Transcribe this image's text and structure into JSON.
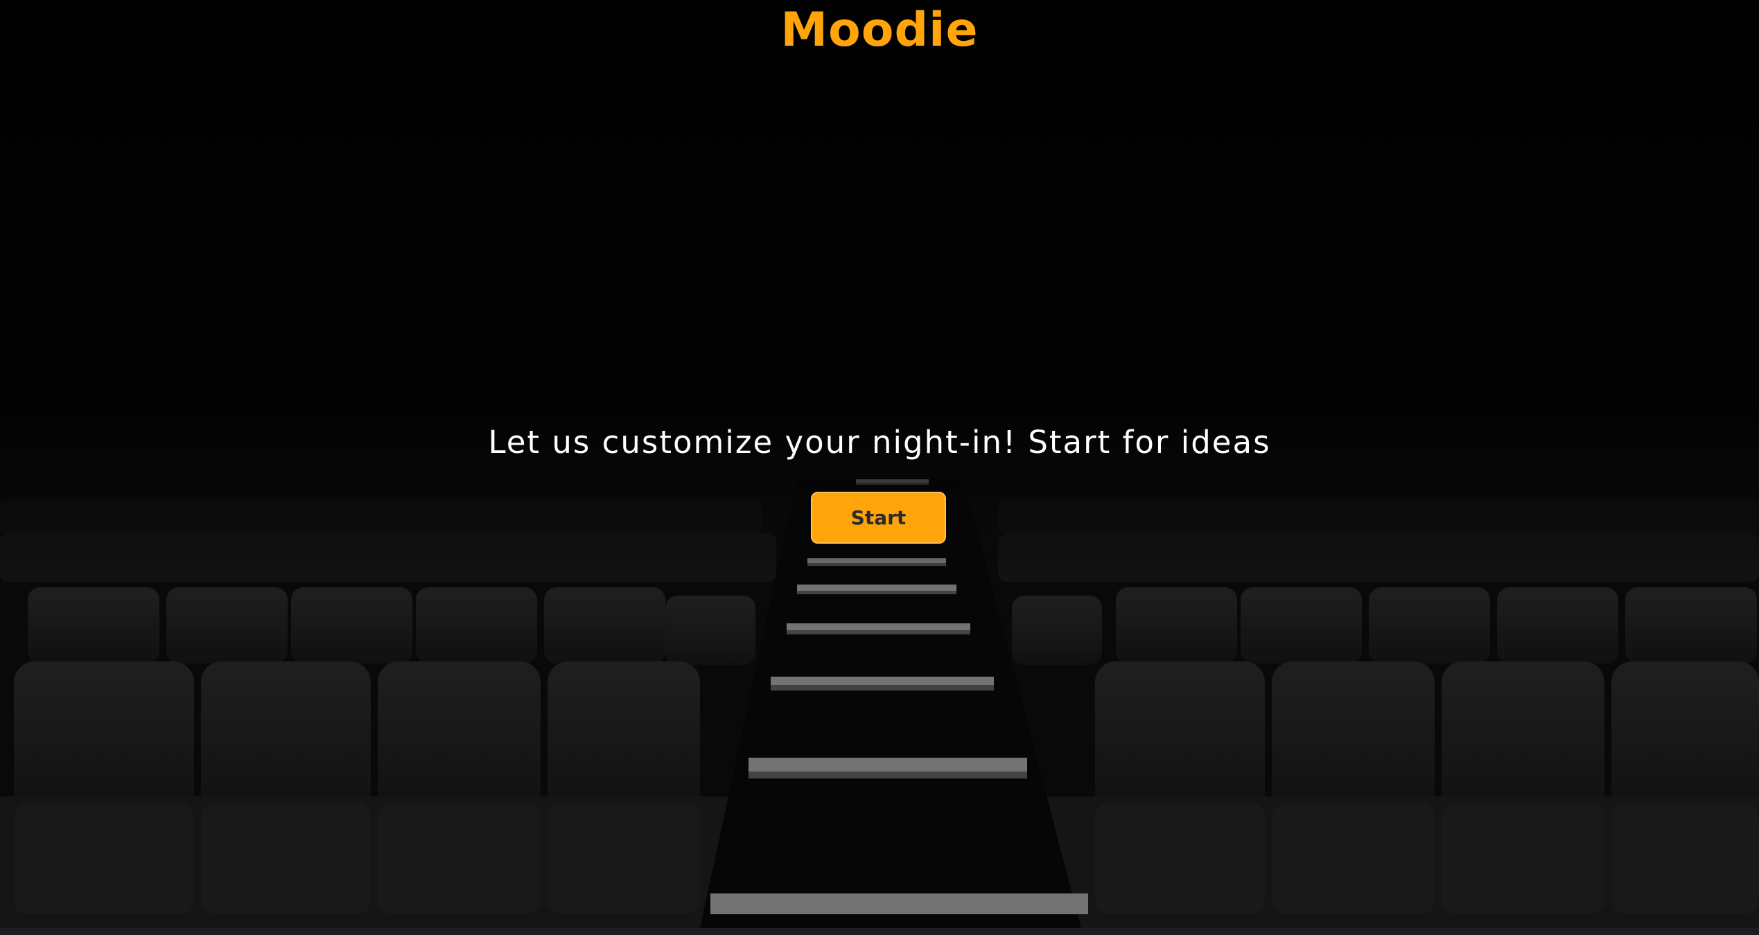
{
  "app": {
    "brand": "Moodie"
  },
  "hero": {
    "tagline": "Let us customize your night-in! Start for ideas",
    "start_label": "Start"
  },
  "theme": {
    "accent": "#ffa40a",
    "text": "#ffffff",
    "background": "#020202"
  },
  "background_image": {
    "subject": "empty-cinema-seats"
  }
}
